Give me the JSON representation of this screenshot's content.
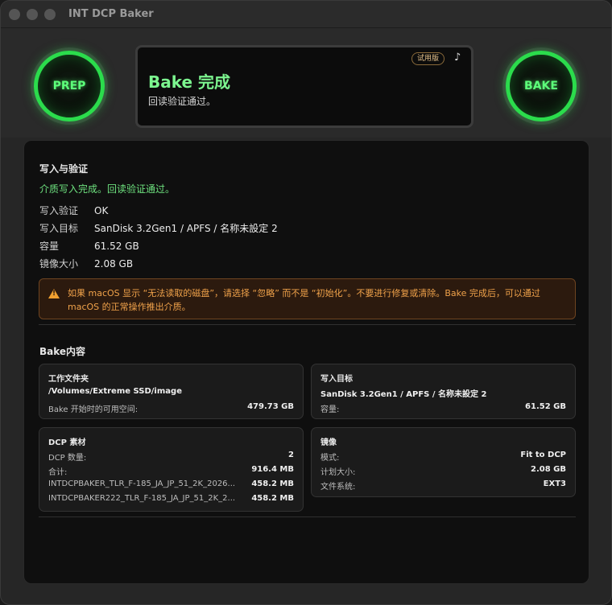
{
  "window": {
    "title": "INT DCP Baker"
  },
  "buttons": {
    "prep": "PREP",
    "bake": "BAKE"
  },
  "status": {
    "title": "Bake 完成",
    "subtitle": "回读验证通过。",
    "trial_badge": "试用版",
    "music_icon": "music-note-icon",
    "music_glyph": "♪"
  },
  "write_section": {
    "title": "写入与验证",
    "message": "介质写入完成。回读验证通过。",
    "rows": [
      {
        "key": "写入验证",
        "value": "OK"
      },
      {
        "key": "写入目标",
        "value": "SanDisk 3.2Gen1 / APFS / 名称未設定 2"
      },
      {
        "key": "容量",
        "value": "61.52 GB"
      },
      {
        "key": "镜像大小",
        "value": "2.08 GB"
      }
    ]
  },
  "warning": {
    "icon": "warning-icon",
    "text": "如果 macOS 显示 “无法读取的磁盘”，请选择 “忽略” 而不是 “初始化”。不要进行修复或清除。Bake 完成后，可以通过 macOS 的正常操作推出介质。"
  },
  "bake_section": {
    "title": "Bake内容",
    "work_folder": {
      "title": "工作文件夹",
      "path": "/Volumes/Extreme SSD/image",
      "space_label": "Bake 开始时的可用空间:",
      "space_value": "479.73 GB"
    },
    "target": {
      "title": "写入目标",
      "name": "SanDisk 3.2Gen1 / APFS / 名称未設定 2",
      "capacity_label": "容量:",
      "capacity_value": "61.52 GB"
    },
    "dcp": {
      "title": "DCP 素材",
      "count_label": "DCP 数量:",
      "count_value": "2",
      "total_label": "合计:",
      "total_value": "916.4 MB",
      "items": [
        {
          "name": "INTDCPBAKER_TLR_F-185_JA_JP_51_2K_2026...",
          "size": "458.2 MB"
        },
        {
          "name": "INTDCPBAKER222_TLR_F-185_JA_JP_51_2K_2...",
          "size": "458.2 MB"
        }
      ]
    },
    "image": {
      "title": "镜像",
      "mode_label": "模式:",
      "mode_value": "Fit to DCP",
      "plan_label": "计划大小:",
      "plan_value": "2.08 GB",
      "fs_label": "文件系统:",
      "fs_value": "EXT3"
    }
  }
}
